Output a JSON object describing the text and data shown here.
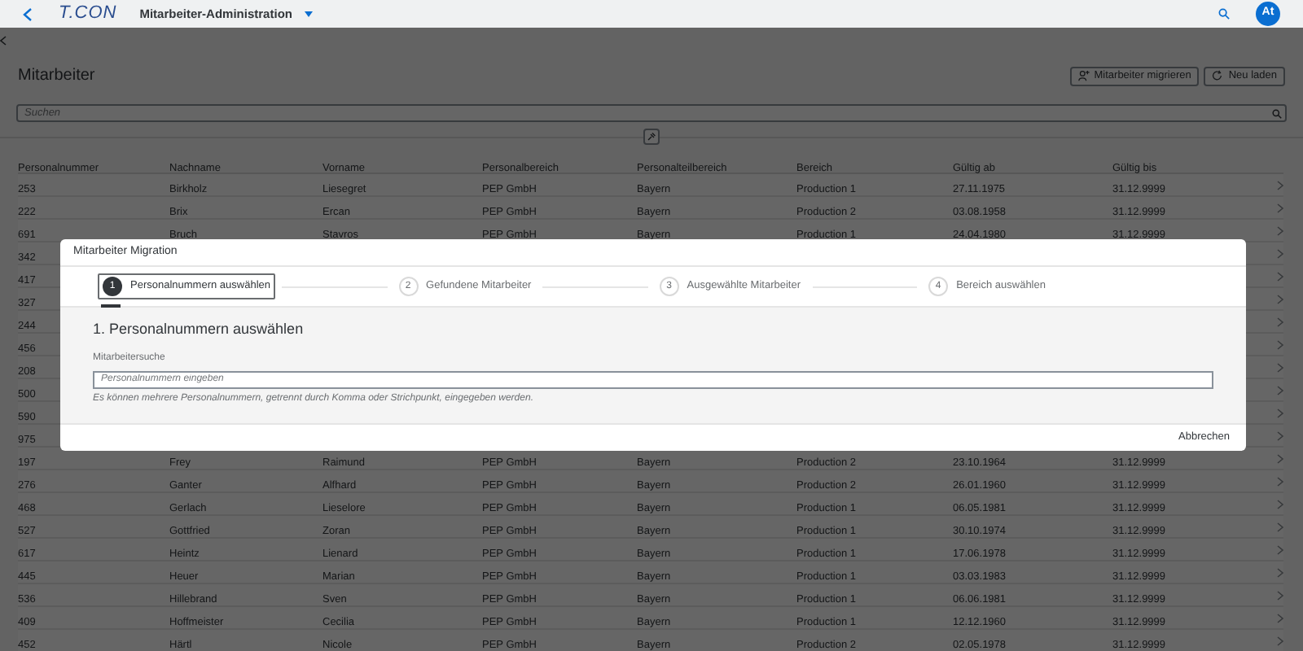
{
  "shell": {
    "logo": "T.CON",
    "title": "Mitarbeiter-Administration",
    "avatar": "At"
  },
  "page": {
    "title": "Mitarbeiter",
    "buttons": [
      {
        "label": "Mitarbeiter migrieren",
        "kind": "migrate"
      },
      {
        "label": "Neu laden",
        "kind": "reload"
      }
    ],
    "search": {
      "placeholder": "Suchen"
    }
  },
  "table": {
    "columns": [
      "Personalnummer",
      "Nachname",
      "Vorname",
      "Personalbereich",
      "Personalteilbereich",
      "Bereich",
      "Gültig ab",
      "Gültig bis"
    ],
    "rows": [
      {
        "cells": [
          "253",
          "Birkholz",
          "Liesegret",
          "PEP GmbH",
          "Bayern",
          "Production 1",
          "27.11.1975",
          "31.12.9999"
        ]
      },
      {
        "cells": [
          "222",
          "Brix",
          "Ercan",
          "PEP GmbH",
          "Bayern",
          "Production 2",
          "03.08.1958",
          "31.12.9999"
        ]
      },
      {
        "cells": [
          "691",
          "Bruch",
          "Stavros",
          "PEP GmbH",
          "Bayern",
          "Production 1",
          "24.04.1980",
          "31.12.9999"
        ]
      },
      {
        "cells": [
          "342"
        ]
      },
      {
        "cells": [
          "417"
        ]
      },
      {
        "cells": [
          "327"
        ]
      },
      {
        "cells": [
          "244"
        ]
      },
      {
        "cells": [
          "456"
        ]
      },
      {
        "cells": [
          "208"
        ]
      },
      {
        "cells": [
          "500"
        ]
      },
      {
        "cells": [
          "590"
        ]
      },
      {
        "cells": [
          "975"
        ]
      },
      {
        "cells": [
          "197",
          "Frey",
          "Raimund",
          "PEP GmbH",
          "Bayern",
          "Production 2",
          "23.10.1964",
          "31.12.9999"
        ]
      },
      {
        "cells": [
          "276",
          "Ganter",
          "Alfhard",
          "PEP GmbH",
          "Bayern",
          "Production 2",
          "26.01.1960",
          "31.12.9999"
        ]
      },
      {
        "cells": [
          "468",
          "Gerlach",
          "Lieselore",
          "PEP GmbH",
          "Bayern",
          "Production 1",
          "06.05.1981",
          "31.12.9999"
        ]
      },
      {
        "cells": [
          "527",
          "Gottfried",
          "Zoran",
          "PEP GmbH",
          "Bayern",
          "Production 1",
          "30.10.1974",
          "31.12.9999"
        ]
      },
      {
        "cells": [
          "617",
          "Heintz",
          "Lienard",
          "PEP GmbH",
          "Bayern",
          "Production 1",
          "17.06.1978",
          "31.12.9999"
        ]
      },
      {
        "cells": [
          "445",
          "Heuer",
          "Marian",
          "PEP GmbH",
          "Bayern",
          "Production 1",
          "03.03.1983",
          "31.12.9999"
        ]
      },
      {
        "cells": [
          "536",
          "Hillebrand",
          "Sven",
          "PEP GmbH",
          "Bayern",
          "Production 1",
          "06.06.1981",
          "31.12.9999"
        ]
      },
      {
        "cells": [
          "409",
          "Hoffmeister",
          "Cecilia",
          "PEP GmbH",
          "Bayern",
          "Production 1",
          "12.12.1960",
          "31.12.9999"
        ]
      },
      {
        "cells": [
          "452",
          "Härtl",
          "Nicole",
          "PEP GmbH",
          "Bayern",
          "Production 2",
          "02.05.1978",
          "31.12.9999"
        ]
      }
    ]
  },
  "dialog": {
    "title": "Mitarbeiter Migration",
    "steps": [
      {
        "number": "1",
        "label": "Personalnummern auswählen",
        "selected": true
      },
      {
        "number": "2",
        "label": "Gefundene Mitarbeiter",
        "selected": false
      },
      {
        "number": "3",
        "label": "Ausgewählte Mitarbeiter",
        "selected": false
      },
      {
        "number": "4",
        "label": "Bereich auswählen",
        "selected": false
      }
    ],
    "section_title": "1. Personalnummern auswählen",
    "field_label": "Mitarbeitersuche",
    "placeholder": "Personalnummern eingeben",
    "hint": "Es können mehrere Personalnummern, getrennt durch Komma oder Strichpunkt, eingegeben werden.",
    "cancel": "Abbrechen"
  }
}
